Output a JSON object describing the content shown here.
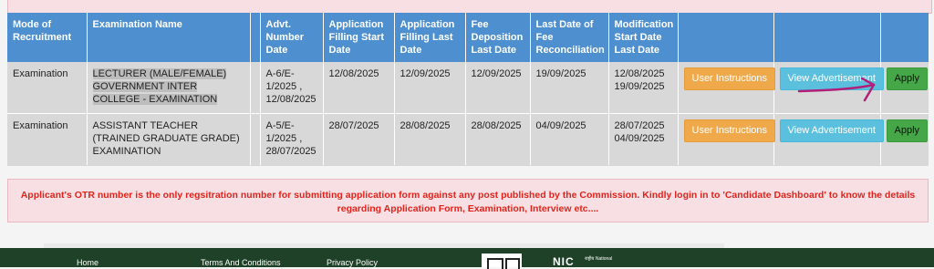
{
  "headers": [
    "Mode of Recruitment",
    "Examination Name",
    "",
    "Advt. Number Date",
    "Application Filling Start Date",
    "Application Filling Last Date",
    "Fee Deposition Last Date",
    "Last Date of Fee Reconciliation",
    "Modification Start Date Last Date",
    "",
    "",
    ""
  ],
  "rows": [
    {
      "mode": "Examination",
      "exam_name": "LECTURER (MALE/FEMALE) GOVERNMENT INTER COLLEGE - EXAMINATION",
      "advt": "A-6/E-1/2025 , 12/08/2025",
      "app_start": "12/08/2025",
      "app_last": "12/09/2025",
      "fee_last": "12/09/2025",
      "fee_recon": "19/09/2025",
      "mod_start": "12/08/2025",
      "mod_last": "19/09/2025",
      "btn_instructions": "User Instructions",
      "btn_advertisement": "View Advertisement",
      "btn_apply": "Apply"
    },
    {
      "mode": "Examination",
      "exam_name": "ASSISTANT TEACHER (TRAINED GRADUATE GRADE) EXAMINATION",
      "advt": "A-5/E-1/2025 , 28/07/2025",
      "app_start": "28/07/2025",
      "app_last": "28/08/2025",
      "fee_last": "28/08/2025",
      "fee_recon": "04/09/2025",
      "mod_start": "28/07/2025",
      "mod_last": "04/09/2025",
      "btn_instructions": "User Instructions",
      "btn_advertisement": "View Advertisement",
      "btn_apply": "Apply"
    }
  ],
  "notice": "Applicant's OTR number is the only regsitration number for submitting application form against any post published by the Commission. Kindly login in to 'Candidate Dashboard' to know the details regarding Application Form, Examination, Interview etc....",
  "footer": {
    "links": [
      "Home",
      "Terms And Conditions",
      "Privacy Policy"
    ],
    "logo_text": "NIC",
    "logo_small": "राष्ट्रीय National"
  },
  "colors": {
    "header_bg": "#4e8fd0",
    "instructions_btn": "#f0a94a",
    "advertisement_btn": "#5bc0de",
    "apply_btn": "#45a747",
    "notice_text": "#e0241b",
    "footer_bg": "#1f4128",
    "annotation_arrow": "#b0207a"
  }
}
